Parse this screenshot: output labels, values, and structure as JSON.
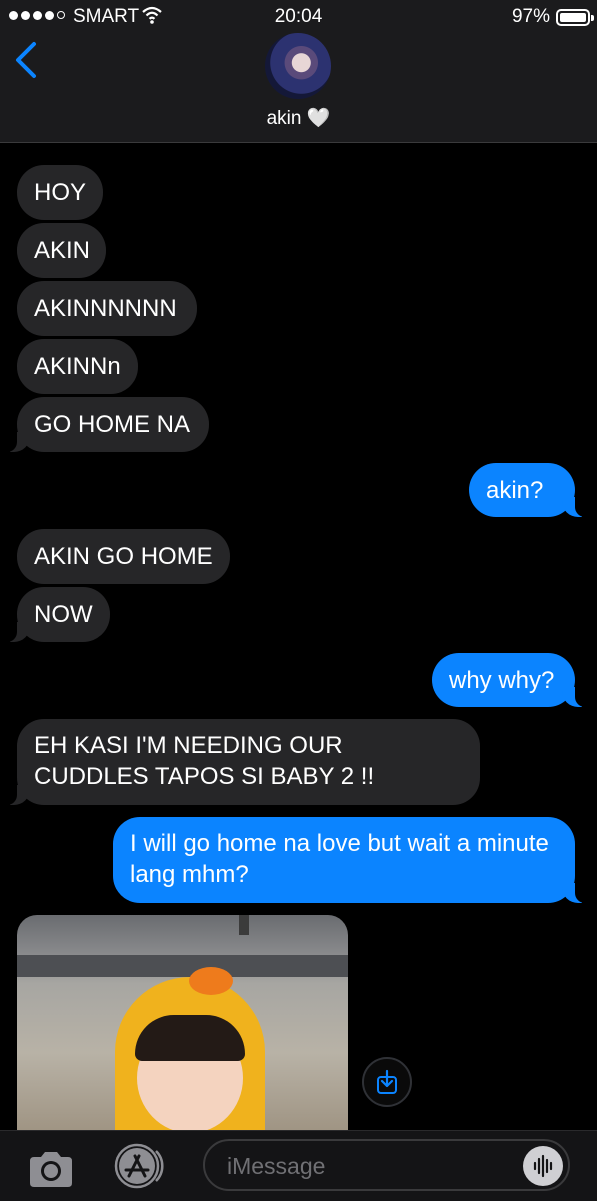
{
  "status_bar": {
    "carrier": "SMART",
    "time": "20:04",
    "battery_percent": "97%",
    "battery_level": 0.97,
    "signal_bars": 4
  },
  "header": {
    "contact_name": "akin 🤍",
    "back_icon": "chevron-left-icon"
  },
  "messages": [
    {
      "from": "them",
      "text": "HOY"
    },
    {
      "from": "them",
      "text": "AKIN"
    },
    {
      "from": "them",
      "text": "AKINNNNNN"
    },
    {
      "from": "them",
      "text": "AKINNn"
    },
    {
      "from": "them",
      "text": "GO HOME NA"
    },
    {
      "from": "me",
      "text": "akin?"
    },
    {
      "from": "them",
      "text": "AKIN GO HOME"
    },
    {
      "from": "them",
      "text": "NOW"
    },
    {
      "from": "me",
      "text": "why why?"
    },
    {
      "from": "them",
      "text": "EH KASI I'M NEEDING OUR CUDDLES TAPOS SI BABY 2 !!"
    },
    {
      "from": "me",
      "text": "I will go home na love but wait a minute lang mhm?"
    },
    {
      "from": "them",
      "type": "photo"
    }
  ],
  "input_bar": {
    "placeholder": "iMessage",
    "camera_icon": "camera-icon",
    "app_icon": "app-store-icon",
    "audio_icon": "audio-waveform-icon"
  },
  "colors": {
    "sent_bubble": "#0b84ff",
    "received_bubble": "#262628",
    "background": "#000000",
    "accent": "#0b84ff"
  }
}
